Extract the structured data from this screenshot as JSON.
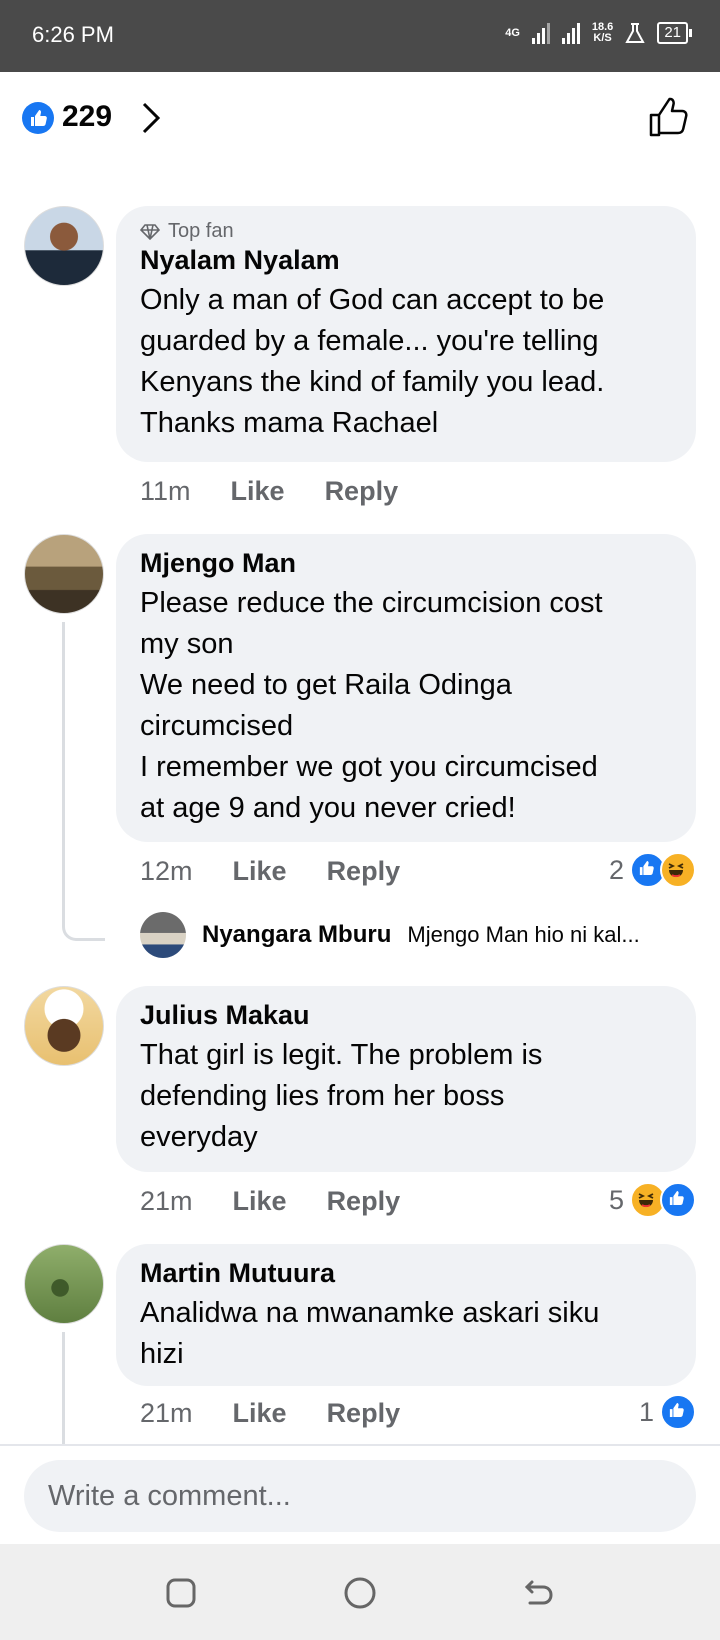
{
  "status_bar": {
    "time": "6:26 PM",
    "net_type": "4G",
    "speed_value": "18.6",
    "speed_unit": "K/S",
    "battery": "21"
  },
  "reactions": {
    "count": "229"
  },
  "comments": [
    {
      "badge": "Top fan",
      "name": "Nyalam Nyalam",
      "text": "Only a man of God can accept to be\nguarded by a female... you're telling\nKenyans the kind of family you lead.\nThanks mama Rachael",
      "time": "11m",
      "like_label": "Like",
      "reply_label": "Reply"
    },
    {
      "name": "Mjengo Man",
      "text": "Please reduce the circumcision cost\nmy son\nWe need to get Raila Odinga\ncircumcised\nI remember we got you circumcised\nat age 9 and you never cried!",
      "time": "12m",
      "like_label": "Like",
      "reply_label": "Reply",
      "reaction_count": "2",
      "reply": {
        "name": "Nyangara Mburu",
        "text": "Mjengo Man hio ni kal..."
      }
    },
    {
      "name": "Julius Makau",
      "text": "That girl is legit. The problem is\ndefending lies from her boss\neveryday",
      "time": "21m",
      "like_label": "Like",
      "reply_label": "Reply",
      "reaction_count": "5"
    },
    {
      "name": "Martin Mutuura",
      "text": "Analidwa na mwanamke askari siku\nhizi",
      "time": "21m",
      "like_label": "Like",
      "reply_label": "Reply",
      "reaction_count": "1"
    }
  ],
  "composer": {
    "placeholder": "Write a comment..."
  },
  "colors": {
    "accent": "#1877f2",
    "bubble": "#f0f2f5",
    "muted": "#65676b",
    "haha": "#f7b125"
  }
}
